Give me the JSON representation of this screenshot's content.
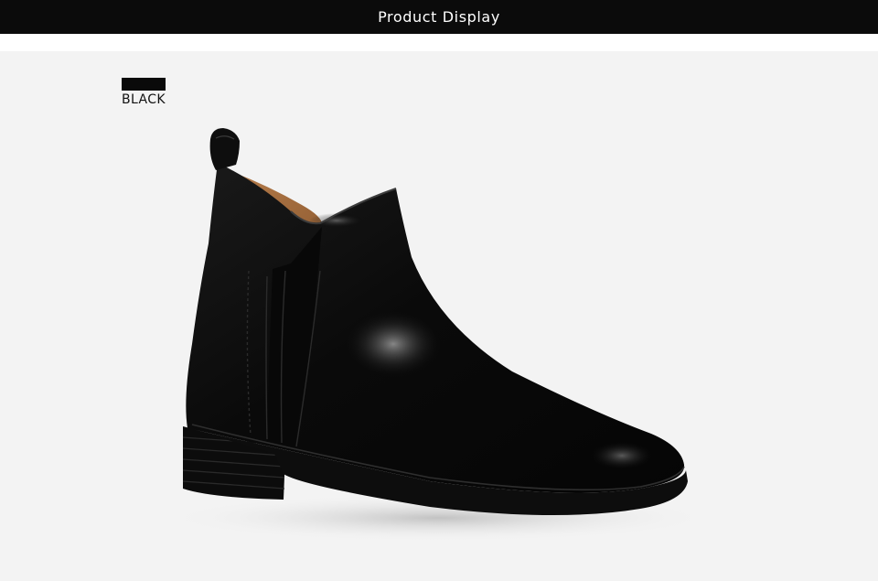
{
  "header": {
    "title": "Product Display"
  },
  "color_option": {
    "label": "BLACK",
    "swatch_color": "#0a0a0a"
  },
  "product": {
    "image_name": "black-leather-chelsea-ankle-boot"
  },
  "theme": {
    "header_bg": "#0b0b0b",
    "stage_bg": "#f3f3f3"
  }
}
